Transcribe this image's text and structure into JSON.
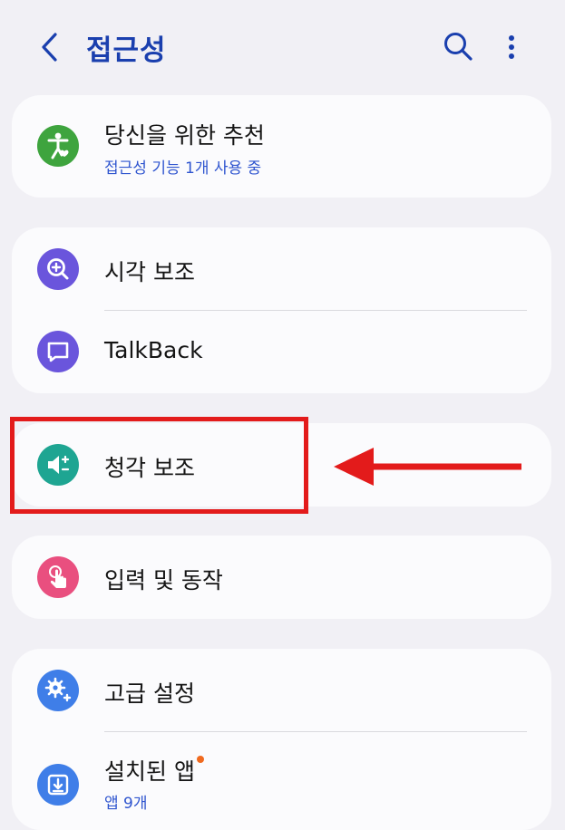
{
  "header": {
    "title": "접근성",
    "back_icon": "chevron-left-icon",
    "search_icon": "search-icon",
    "more_icon": "more-vertical-icon",
    "accent_color": "#1a3fae"
  },
  "recommend": {
    "label": "당신을 위한 추천",
    "sub": "접근성 기능 1개 사용 중",
    "icon": "accessibility-person-icon",
    "icon_color": "#3ea43e"
  },
  "vision_group": {
    "items": [
      {
        "label": "시각 보조",
        "icon": "magnifier-icon",
        "icon_color": "#6a55dc"
      },
      {
        "label": "TalkBack",
        "icon": "chat-bubble-icon",
        "icon_color": "#6a55dc"
      }
    ]
  },
  "hearing": {
    "label": "청각 보조",
    "icon": "speaker-icon",
    "icon_color": "#1ea592"
  },
  "interaction": {
    "label": "입력 및 동작",
    "icon": "touch-hand-icon",
    "icon_color": "#e94f7f"
  },
  "advanced_group": {
    "items": [
      {
        "label": "고급 설정",
        "icon": "gears-plus-icon",
        "icon_color": "#3f7ee8"
      },
      {
        "label": "설치된 앱",
        "sub": "앱 9개",
        "icon": "download-icon",
        "icon_color": "#3f7ee8",
        "badge_color": "#f06a1f"
      }
    ]
  },
  "annotation": {
    "highlight_color": "#e31b1b"
  }
}
